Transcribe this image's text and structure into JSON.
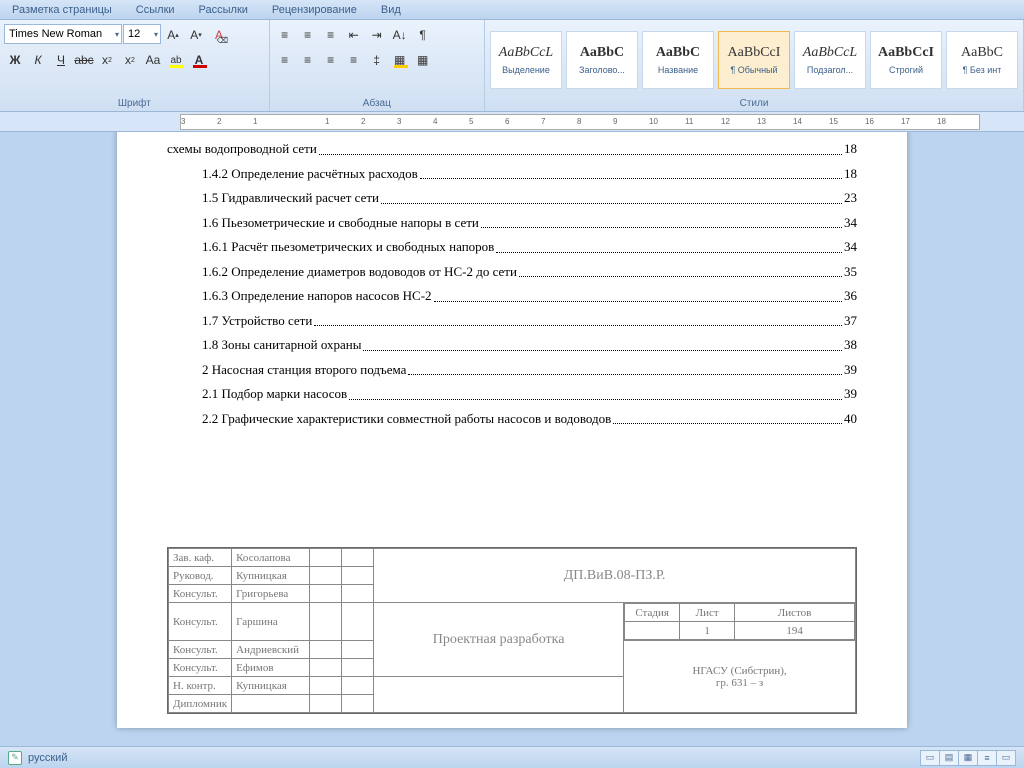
{
  "tabs": [
    "Разметка страницы",
    "Ссылки",
    "Рассылки",
    "Рецензирование",
    "Вид"
  ],
  "font": {
    "name": "Times New Roman",
    "size": "12"
  },
  "group_labels": {
    "font": "Шрифт",
    "para": "Абзац",
    "styles": "Стили"
  },
  "styles": [
    {
      "preview": "AaBbCcL",
      "name": "Выделение",
      "italic": true
    },
    {
      "preview": "AaBbC",
      "name": "Заголово...",
      "bold": true
    },
    {
      "preview": "AaBbC",
      "name": "Название",
      "bold": true
    },
    {
      "preview": "AaBbCcI",
      "name": "¶ Обычный",
      "selected": true
    },
    {
      "preview": "AaBbCcL",
      "name": "Подзагол...",
      "italic": true
    },
    {
      "preview": "AaBbCcI",
      "name": "Строгий",
      "bold": true
    },
    {
      "preview": "AaBbC",
      "name": "¶ Без инт"
    }
  ],
  "ruler_ticks": [
    "3",
    "2",
    "1",
    "",
    "1",
    "2",
    "3",
    "4",
    "5",
    "6",
    "7",
    "8",
    "9",
    "10",
    "11",
    "12",
    "13",
    "14",
    "15",
    "16",
    "17",
    "18"
  ],
  "toc": [
    {
      "text": "схемы водопроводной сети",
      "page": "18",
      "indent": 0
    },
    {
      "text": "1.4.2 Определение расчётных расходов",
      "page": "18",
      "indent": 1
    },
    {
      "text": "1.5 Гидравлический расчет сети",
      "page": "23",
      "indent": 1
    },
    {
      "text": "1.6 Пьезометрические и свободные напоры в сети",
      "page": "34",
      "indent": 1
    },
    {
      "text": "1.6.1 Расчёт пьезометрических и свободных напоров",
      "page": "34",
      "indent": 1
    },
    {
      "text": "1.6.2 Определение диаметров водоводов от НС-2 до сети",
      "page": "35",
      "indent": 1
    },
    {
      "text": "1.6.3 Определение напоров насосов НС-2",
      "page": "36",
      "indent": 1
    },
    {
      "text": "1.7 Устройство сети",
      "page": "37",
      "indent": 1
    },
    {
      "text": "1.8 Зоны санитарной охраны",
      "page": "38",
      "indent": 1
    },
    {
      "text": "2 Насосная станция второго подъема",
      "page": "39",
      "indent": 1
    },
    {
      "text": "2.1 Подбор марки насосов",
      "page": "39",
      "indent": 1
    },
    {
      "text": "2.2 Графические характеристики совместной работы насосов и водоводов",
      "page": "40",
      "indent": 1
    }
  ],
  "stamp": {
    "rows": [
      {
        "role": "Зав. каф.",
        "name": "Косолапова"
      },
      {
        "role": "Руковод.",
        "name": "Купницкая"
      },
      {
        "role": "Консульт.",
        "name": "Григорьева"
      },
      {
        "role": "Консульт.",
        "name": "Гаршина"
      },
      {
        "role": "Консульт.",
        "name": "Андриевский"
      },
      {
        "role": "Консульт.",
        "name": "Ефимов"
      },
      {
        "role": "Н. контр.",
        "name": "Купницкая"
      },
      {
        "role": "Дипломник",
        "name": ""
      }
    ],
    "code": "ДП.ВиВ.08-ПЗ.Р.",
    "title": "Проектная разработка",
    "headers": {
      "stage": "Стадия",
      "sheet": "Лист",
      "sheets": "Листов"
    },
    "vals": {
      "stage": "",
      "sheet": "1",
      "sheets": "194"
    },
    "org": "НГАСУ (Сибстрин),\nгр. 631 – з"
  },
  "status": {
    "lang": "русский"
  }
}
